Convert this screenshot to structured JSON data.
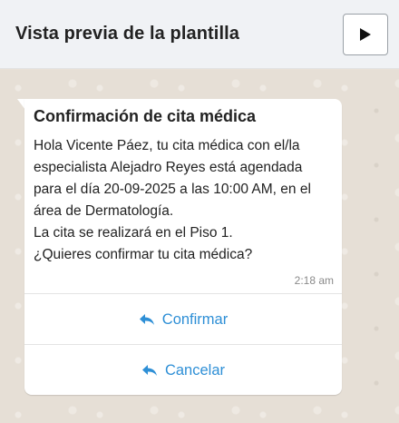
{
  "header": {
    "title": "Vista previa de la plantilla",
    "play_icon": "play-icon"
  },
  "message": {
    "title": "Confirmación de cita médica",
    "body_lines": [
      "Hola Vicente Páez, tu cita médica con el/la",
      "especialista Alejadro Reyes está agendada",
      "para el día 20-09-2025 a las 10:00 AM, en el",
      "área de Dermatología.",
      "La cita se realizará en el Piso 1.",
      "¿Quieres confirmar tu cita médica?"
    ],
    "time": "2:18 am"
  },
  "actions": [
    {
      "label": "Confirmar",
      "icon": "reply-icon"
    },
    {
      "label": "Cancelar",
      "icon": "reply-icon"
    }
  ],
  "colors": {
    "accent": "#2e8fd6",
    "header_bg": "#f0f2f5",
    "chat_bg": "#e6dfd6",
    "bubble_bg": "#ffffff"
  }
}
